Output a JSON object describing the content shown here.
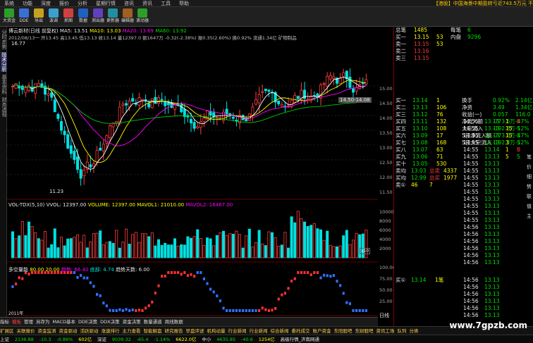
{
  "menu": [
    "系统",
    "功能",
    "深度",
    "报价",
    "分析",
    "星期行情",
    "咨讯",
    "资讯",
    "工具",
    "帮助"
  ],
  "ticker": "【港股】中国海景中期盈转亏近743.5万元 不",
  "toolbar": [
    {
      "label": "大资金",
      "color": "#2a9f2a"
    },
    {
      "label": "DDE",
      "color": "#3a6fd6"
    },
    {
      "label": "导出",
      "color": "#c8a020"
    },
    {
      "label": "波调",
      "color": "#3aa0d0"
    },
    {
      "label": "抓图",
      "color": "#d04040"
    },
    {
      "label": "数据",
      "color": "#2060c0"
    },
    {
      "label": "测出器",
      "color": "#6040c0"
    },
    {
      "label": "更新器",
      "color": "#2090a0"
    },
    {
      "label": "编辑器",
      "color": "#a06020"
    },
    {
      "label": "滚动器",
      "color": "#2a9f2a"
    }
  ],
  "leftbar": [
    "分时走势",
    "技术分析",
    "基本资料",
    "财务透视"
  ],
  "price_header": {
    "name": "博云新材(日线 前复权)",
    "ma5": "MA5: 13.51",
    "ma10": "MA10: 13.03",
    "ma20": "MA20: 13.69",
    "ma60": "MA60: 13.92",
    "line2": "2012/08/13一 开13.45 高13.45 低13.13 收13.14 量12397.0 额1647万 -0.32(-2.38%) 振0.35(2.60%) 换0.92% 流通1.34亿 矿物制品",
    "hi_label": "16.77",
    "lo_label": "11.23",
    "box_label": "14.50-14.08"
  },
  "price_axis": [
    "15.00",
    "14.50",
    "14.00",
    "13.50",
    "13.00",
    "12.50",
    "12.00",
    "11.50"
  ],
  "volume_header": {
    "ind": "VOL-TDX(5,10)",
    "vvol": "VVOL: 12397.00",
    "vol": "VOLUME: 12397.00",
    "mavol1": "MAVOL1: 21010.00",
    "mavol2": "MAVOL2: 16467.00",
    "unit": "x10"
  },
  "volume_axis": [
    "10000",
    "8000",
    "6000",
    "4000",
    "2000"
  ],
  "osc_header": {
    "name": "多空量能",
    "v1": "80.00",
    "v2": "20.00",
    "v3": "趋势: 66.40",
    "v4": "底部: 4.74",
    "v5": "趋势天数: 6.00"
  },
  "osc_axis": [
    "100.00",
    "75.00",
    "50.00",
    "25.00"
  ],
  "x_year": "2011年",
  "bottom_tabs": [
    "指标",
    "模板",
    "管理",
    "另存为",
    "MACD基本",
    "DDE决策",
    "DDX决策",
    "资金决策",
    "数量通道",
    "周线数据"
  ],
  "axis_caption": "日线",
  "rightpanel": {
    "top": [
      {
        "k": "总笔",
        "v": "1485",
        "k2": "每笔",
        "v2": "6"
      },
      {
        "k": "买一",
        "v": "13.15",
        "n": "53",
        "k2": "内盘",
        "v2": "9296"
      }
    ],
    "sells": [
      {
        "k": "卖一",
        "p": "13.15",
        "n": "53"
      },
      {
        "k": "卖二",
        "p": "13.16",
        "n": ""
      },
      {
        "k": "卖三",
        "p": "13.15",
        "n": ""
      }
    ],
    "stats": [
      {
        "k": "换手",
        "v": "0.92%",
        "k2": "股本",
        "v2": "2.14亿"
      },
      {
        "k": "净资",
        "v": "3.49",
        "k2": "流通",
        "v2": "1.34亿"
      },
      {
        "k": "收益(一)",
        "v": "0.057",
        "k2": "PE(动)",
        "v2": "116.0"
      },
      {
        "k": "净流入额",
        "v": "-773.6万",
        "v2": "-47%"
      },
      {
        "k": "大宗流入",
        "v": "-192.3万",
        "v2": "-12%"
      },
      {
        "k": "5日净流入额",
        "v": "-773.6万",
        "v2": "-47%"
      },
      {
        "k": "5日大宗流入",
        "v": "-192.3万",
        "v2": "-12%"
      }
    ],
    "buys": [
      {
        "k": "买一",
        "p": "13.14",
        "n": "1"
      },
      {
        "k": "买二",
        "p": "13.13",
        "n": "106"
      },
      {
        "k": "买三",
        "p": "13.12",
        "n": "76"
      },
      {
        "k": "买四",
        "p": "13.11",
        "n": "132"
      },
      {
        "k": "买五",
        "p": "13.10",
        "n": "108"
      },
      {
        "k": "买六",
        "p": "13.09",
        "n": "17"
      },
      {
        "k": "买七",
        "p": "13.08",
        "n": "168"
      },
      {
        "k": "买八",
        "p": "13.07",
        "n": "63"
      },
      {
        "k": "买九",
        "p": "13.06",
        "n": "71"
      },
      {
        "k": "买十",
        "p": "13.05",
        "n": "530"
      }
    ],
    "summary": [
      {
        "k": "卖均",
        "v": "13.03",
        "k2": "总卖",
        "v2": "4337"
      },
      {
        "k": "买均",
        "v": "12.99",
        "k2": "总买",
        "v2": "1977"
      }
    ],
    "last_row": {
      "k": "卖①",
      "v": "46",
      "v2": "7"
    },
    "ticks": [
      {
        "t": "14:55",
        "p": "13.13",
        "n": "1",
        "s": "B"
      },
      {
        "t": "14:55",
        "p": "13.13",
        "n": "15",
        "s": "S"
      },
      {
        "t": "14:55",
        "p": "13.13",
        "n": "15",
        "s": "S"
      },
      {
        "t": "14:55",
        "p": "13.13",
        "n": "3",
        "s": "S"
      },
      {
        "t": "14:55",
        "p": "13.14",
        "n": "1",
        "s": "B"
      },
      {
        "t": "14:55",
        "p": "13.13",
        "n": "5",
        "s": "S"
      },
      {
        "t": "14:55",
        "p": "13.13",
        "n": "",
        "s": ""
      },
      {
        "t": "14:55",
        "p": "13.13",
        "n": "",
        "s": ""
      },
      {
        "t": "14:55",
        "p": "13.13",
        "n": "",
        "s": ""
      },
      {
        "t": "14:55",
        "p": "13.13",
        "n": "",
        "s": ""
      },
      {
        "t": "14:55",
        "p": "13.13",
        "n": "",
        "s": ""
      },
      {
        "t": "14:55",
        "p": "13.13",
        "n": "",
        "s": ""
      },
      {
        "t": "14:55",
        "p": "13.13",
        "n": "",
        "s": ""
      },
      {
        "t": "14:55",
        "p": "13.13",
        "n": "",
        "s": ""
      },
      {
        "t": "14:55",
        "p": "13.13",
        "n": "",
        "s": ""
      },
      {
        "t": "14:56",
        "p": "13.13",
        "n": "",
        "s": ""
      },
      {
        "t": "14:56",
        "p": "13.13",
        "n": "",
        "s": ""
      },
      {
        "t": "14:56",
        "p": "13.13",
        "n": "",
        "s": ""
      },
      {
        "t": "14:56",
        "p": "13.13",
        "n": "",
        "s": ""
      },
      {
        "t": "14:56",
        "p": "13.13",
        "n": "",
        "s": ""
      },
      {
        "t": "14:56",
        "p": "13.13",
        "n": "",
        "s": ""
      }
    ],
    "bottom_order": {
      "k": "买①",
      "p": "13.14",
      "n": "1笔"
    },
    "bottom_ticks": [
      {
        "t": "14:56",
        "p": "13.13",
        "n": "",
        "s": ""
      },
      {
        "t": "14:56",
        "p": "13.13",
        "n": "",
        "s": ""
      },
      {
        "t": "14:56",
        "p": "13.13",
        "n": "",
        "s": ""
      },
      {
        "t": "14:56",
        "p": "13.13",
        "n": "",
        "s": ""
      },
      {
        "t": "14:56",
        "p": "13.13",
        "n": "",
        "s": ""
      },
      {
        "t": "14:56",
        "p": "13.13",
        "n": "",
        "s": ""
      }
    ],
    "tabs": [
      "笔",
      "价",
      "细",
      "势",
      "联",
      "值",
      "主"
    ]
  },
  "bizrow": [
    "扩展区",
    "关联报价",
    "资金监测",
    "资金驱动",
    "活跃驱动",
    "涨速排行",
    "主力查看",
    "智能解盘",
    "研究报告",
    "早盘评述",
    "机构动量",
    "行业新闻",
    "行业新闻",
    "综合新闻",
    "委托成交",
    "账户资金",
    "东阳股吧",
    "东财股吧",
    "资讯工场",
    "队列",
    "分类"
  ],
  "status": {
    "a1": "上证",
    "a2": "2136.88",
    "a3": "-10.3",
    "a4": "-0.86%",
    "a5": "602亿",
    "b1": "深证",
    "b2": "9039.32",
    "b3": "-65.4",
    "b4": "-1.14%",
    "b5": "6622.0亿",
    "c1": "中小",
    "c2": "4635.85",
    "c3": "-40.6",
    "c4": "1254亿",
    "d1": "高级行情_济南网通"
  },
  "watermark": "www.7gpzb.com",
  "colors": {
    "up": "#ff3b3b",
    "down": "#00e0e0",
    "ma5": "#ffffff",
    "ma10": "#ffff00",
    "ma20": "#ff00ff",
    "ma60": "#00cc00"
  }
}
